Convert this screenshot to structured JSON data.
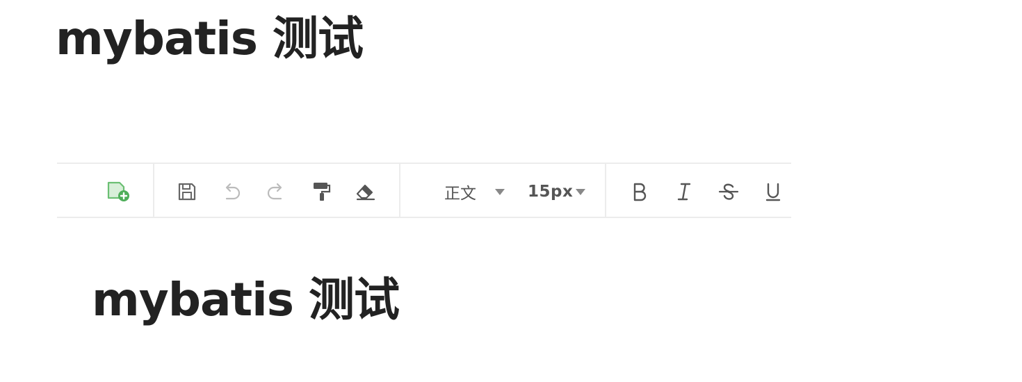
{
  "page": {
    "title": "mybatis 测试"
  },
  "toolbar": {
    "paragraph_style": "正文",
    "font_size": "15px",
    "icons": {
      "insert_page": "page-add-icon",
      "save": "save-icon",
      "undo": "undo-icon",
      "redo": "redo-icon",
      "format_painter": "paint-roller-icon",
      "clear_format": "eraser-icon",
      "bold": "bold-icon",
      "italic": "italic-icon",
      "strikethrough": "strikethrough-icon",
      "underline": "underline-icon"
    }
  },
  "editor": {
    "heading": "mybatis 测试"
  },
  "colors": {
    "text": "#222222",
    "icon": "#666666",
    "icon_disabled": "#bbbbbb",
    "accent_green": "#6bbf73",
    "border": "#ececec"
  }
}
